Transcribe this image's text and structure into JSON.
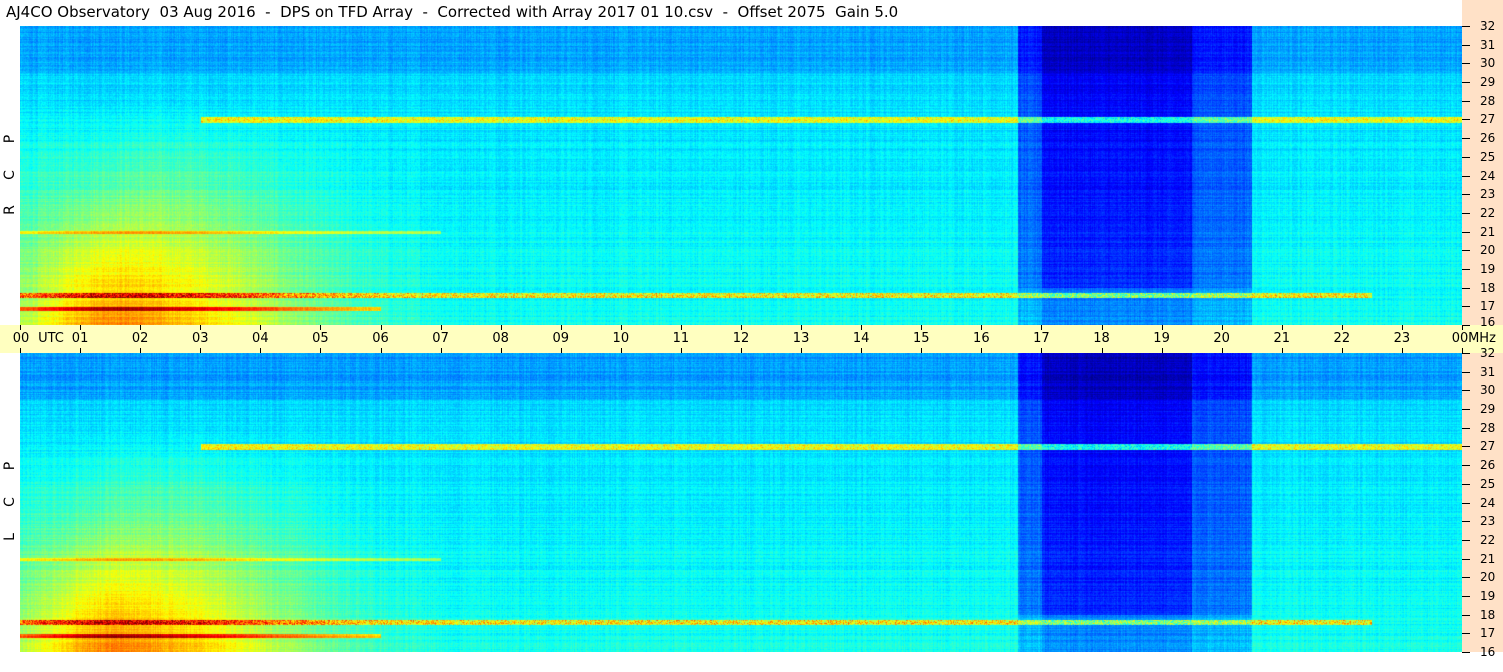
{
  "title": "AJ4CO Observatory  03 Aug 2016  -  DPS on TFD Array  -  Corrected with Array 2017 01 10.csv  -  Offset 2075  Gain 5.0",
  "panels": [
    {
      "id": "top",
      "label": [
        "R",
        "C",
        "P"
      ]
    },
    {
      "id": "bottom",
      "label": [
        "L",
        "C",
        "P"
      ]
    }
  ],
  "colors": {
    "background": "#ffffff",
    "time_band": "#ffffc0",
    "freq_axis": "#ffe1c7"
  },
  "chart_data": {
    "type": "heatmap",
    "x_axis": {
      "unit_label": "UTC",
      "tick_labels": [
        "00",
        "01",
        "02",
        "03",
        "04",
        "05",
        "06",
        "07",
        "08",
        "09",
        "10",
        "11",
        "12",
        "13",
        "14",
        "15",
        "16",
        "17",
        "18",
        "19",
        "20",
        "21",
        "22",
        "23",
        "00"
      ],
      "range": [
        0,
        24
      ]
    },
    "y_axis": {
      "unit_label": "MHz",
      "tick_labels": [
        "32",
        "31",
        "30",
        "29",
        "28",
        "27",
        "26",
        "25",
        "24",
        "23",
        "22",
        "21",
        "20",
        "19",
        "18",
        "17",
        "16"
      ],
      "range": [
        16,
        32
      ]
    },
    "colormap": "jet",
    "features": [
      {
        "kind": "low-frequency broadband emission",
        "utc_start": 0,
        "utc_end": 6.5,
        "freq_low": 16,
        "freq_high": 28
      },
      {
        "kind": "depressed background",
        "utc_start": 16.5,
        "utc_end": 20.5,
        "freq_low": 16,
        "freq_high": 32
      },
      {
        "kind": "narrowband interference",
        "freq_mhz": 27.0,
        "utc_start": 3,
        "utc_end": 24
      },
      {
        "kind": "narrowband interference",
        "freq_mhz": 17.6,
        "utc_start": 0,
        "utc_end": 22.5
      }
    ]
  }
}
